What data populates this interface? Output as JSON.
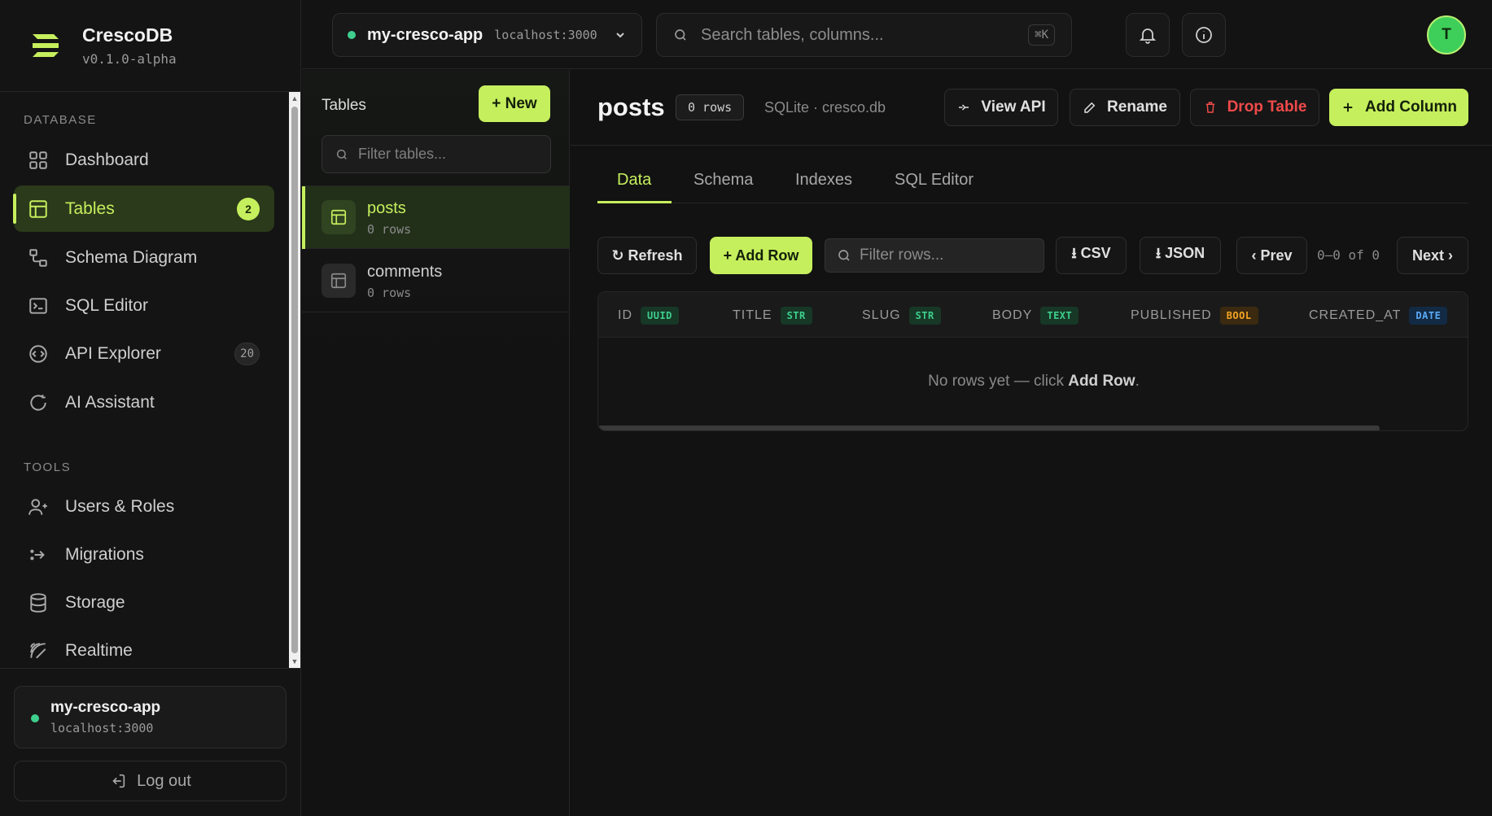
{
  "brand": {
    "name": "CrescoDB",
    "version": "v0.1.0-alpha"
  },
  "sidebar": {
    "section_database": "DATABASE",
    "section_tools": "TOOLS",
    "items": [
      {
        "label": "Dashboard",
        "icon": "grid-icon"
      },
      {
        "label": "Tables",
        "icon": "table-icon",
        "badge": "2",
        "active": true
      },
      {
        "label": "Schema Diagram",
        "icon": "diagram-icon"
      },
      {
        "label": "SQL Editor",
        "icon": "terminal-icon"
      },
      {
        "label": "API Explorer",
        "icon": "api-icon",
        "badge": "20"
      },
      {
        "label": "AI Assistant",
        "icon": "ai-icon"
      }
    ],
    "tools": [
      {
        "label": "Users & Roles",
        "icon": "users-icon"
      },
      {
        "label": "Migrations",
        "icon": "migrations-icon"
      },
      {
        "label": "Storage",
        "icon": "database-icon"
      },
      {
        "label": "Realtime",
        "icon": "signal-icon"
      }
    ],
    "project": {
      "name": "my-cresco-app",
      "host": "localhost:3000"
    },
    "logout_label": "Log out"
  },
  "topbar": {
    "project_name": "my-cresco-app",
    "project_host": "localhost:3000",
    "search_placeholder": "Search tables, columns...",
    "search_shortcut": "⌘K",
    "avatar_initial": "T"
  },
  "tables_panel": {
    "title": "Tables",
    "new_label": "+ New",
    "filter_placeholder": "Filter tables...",
    "tables": [
      {
        "name": "posts",
        "rows": "0 rows",
        "active": true
      },
      {
        "name": "comments",
        "rows": "0 rows"
      }
    ]
  },
  "main": {
    "table_name": "posts",
    "row_count": "0 rows",
    "db_info": "SQLite · cresco.db",
    "view_api_label": "View API",
    "rename_label": "Rename",
    "drop_label": "Drop Table",
    "add_column_label": "Add Column",
    "tabs": [
      "Data",
      "Schema",
      "Indexes",
      "SQL Editor"
    ],
    "toolbar": {
      "refresh_label": "↻ Refresh",
      "add_row_label": "+ Add Row",
      "filter_placeholder": "Filter rows...",
      "csv_label": "⭳ CSV",
      "json_label": "⭳ JSON",
      "prev_label": "‹ Prev",
      "page_info": "0–0 of 0",
      "next_label": "Next ›"
    },
    "columns": [
      {
        "name": "ID",
        "type": "UUID"
      },
      {
        "name": "TITLE",
        "type": "STR"
      },
      {
        "name": "SLUG",
        "type": "STR"
      },
      {
        "name": "BODY",
        "type": "TEXT"
      },
      {
        "name": "PUBLISHED",
        "type": "BOOL"
      },
      {
        "name": "CREATED_AT",
        "type": "DATE"
      }
    ],
    "empty_prefix": "No rows yet — click ",
    "empty_action": "Add Row",
    "empty_suffix": "."
  },
  "colors": {
    "accent": "#c6ef5d",
    "danger": "#f04a4a",
    "online": "#3ecf8e",
    "background": "#121212"
  }
}
